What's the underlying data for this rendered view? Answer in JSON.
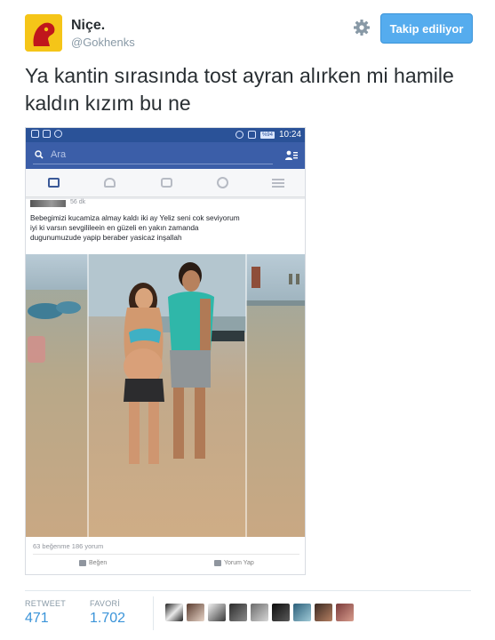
{
  "tweet": {
    "display_name": "Niçe.",
    "handle": "@Gokhenks",
    "follow_button": "Takip ediliyor",
    "text": "Ya kantin sırasında tost ayran alırken mi hamile kaldın kızım bu ne"
  },
  "embedded_screenshot": {
    "status_bar": {
      "battery": "%94",
      "time": "10:24"
    },
    "search": {
      "placeholder": "Ara"
    },
    "post": {
      "time": "56 dk",
      "text_lines": [
        "Bebegimizi kucamiza almay kaldı iki ay Yeliz seni cok seviyorum",
        "iyi ki varsın  sevgilileein en güzeli en yakın zamanda",
        "dugunumuzude yapip beraber yasicaz inşallah"
      ],
      "stats": "63 beğenme  186 yorum",
      "like_label": "Beğen",
      "comment_label": "Yorum Yap"
    }
  },
  "stats": {
    "retweet_label": "RETWEET",
    "retweet_count": "471",
    "favorite_label": "FAVORİ",
    "favorite_count": "1.702"
  },
  "colors": {
    "twitter_blue": "#55acee",
    "facebook_blue": "#3b5998",
    "stat_blue": "#3b94d9"
  },
  "icons": [
    "settings-gear-icon",
    "search-icon",
    "friend-requests-icon",
    "news-feed-icon",
    "friends-icon",
    "messages-icon",
    "globe-icon",
    "menu-icon",
    "like-icon",
    "comment-icon"
  ]
}
